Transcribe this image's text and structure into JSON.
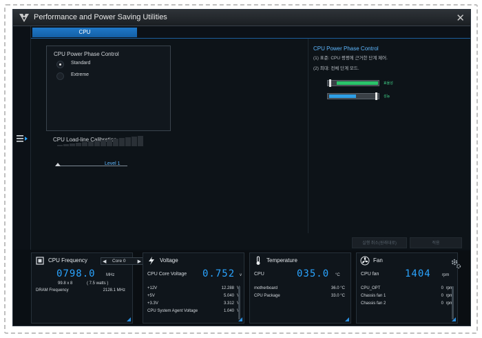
{
  "window": {
    "title": "Performance and Power Saving Utilities",
    "close_glyph": "✕"
  },
  "tabs": [
    {
      "label": "CPU"
    }
  ],
  "phase_control": {
    "title": "CPU Power Phase Control",
    "options": [
      {
        "label": "Standard",
        "checked": true
      },
      {
        "label": "Extreme",
        "checked": false
      }
    ]
  },
  "llc": {
    "title": "CPU Load-line Calibration",
    "level": "Level 1"
  },
  "help": {
    "title": "CPU Power Phase Control",
    "line1": "(1) 표준: CPU 평평에 근거한 단계 제어.",
    "line2": "(2) 최대: 전체 단계 모드.",
    "bar1_label": "효율성",
    "bar2_label": "성능",
    "bar1_level": 0.85,
    "bar2_level": 0.55,
    "colors": {
      "efficiency": "#2ac46a",
      "performance": "#2e9fe6"
    }
  },
  "buttons": {
    "undo": "실행 취소(원래대로)",
    "apply": "적용"
  },
  "cpu_freq": {
    "title": "CPU Frequency",
    "core_select": "Core 0",
    "value": "0798.0",
    "unit": "MHz",
    "ratio": "99.8  x  8",
    "watts": "( 7.5    watts )",
    "dram_label": "DRAM Frequency",
    "dram_value": "2128.1  MHz"
  },
  "voltage": {
    "title": "Voltage",
    "core_label": "CPU Core Voltage",
    "core_value": "0.752",
    "core_unit": "v",
    "rows": [
      {
        "label": "+12V",
        "value": "12.288",
        "unit": "V"
      },
      {
        "label": "+5V",
        "value": "5.040",
        "unit": "V"
      },
      {
        "label": "+3.3V",
        "value": "3.312",
        "unit": "V"
      },
      {
        "label": "CPU System Agent Voltage",
        "value": "1.040",
        "unit": "V"
      }
    ]
  },
  "temperature": {
    "title": "Temperature",
    "cpu_label": "CPU",
    "cpu_value": "035.0",
    "cpu_unit": "°C",
    "rows": [
      {
        "label": "motherboard",
        "value": "36.0 °C"
      },
      {
        "label": "CPU Package",
        "value": "33.0 °C"
      }
    ]
  },
  "fan": {
    "title": "Fan",
    "cpu_label": "CPU fan",
    "cpu_value": "1404",
    "cpu_unit": "rpm",
    "rows": [
      {
        "label": "CPU_OPT",
        "value": "0",
        "unit": "rpm"
      },
      {
        "label": "Chassis fan 1",
        "value": "0",
        "unit": "rpm"
      },
      {
        "label": "Chassis fan 2",
        "value": "0",
        "unit": "rpm"
      }
    ]
  },
  "icons": [
    "tuf-logo-icon",
    "close-icon",
    "menu-expand-icon",
    "chip-icon",
    "lightning-icon",
    "thermometer-icon",
    "fan-icon",
    "gear-icon"
  ]
}
